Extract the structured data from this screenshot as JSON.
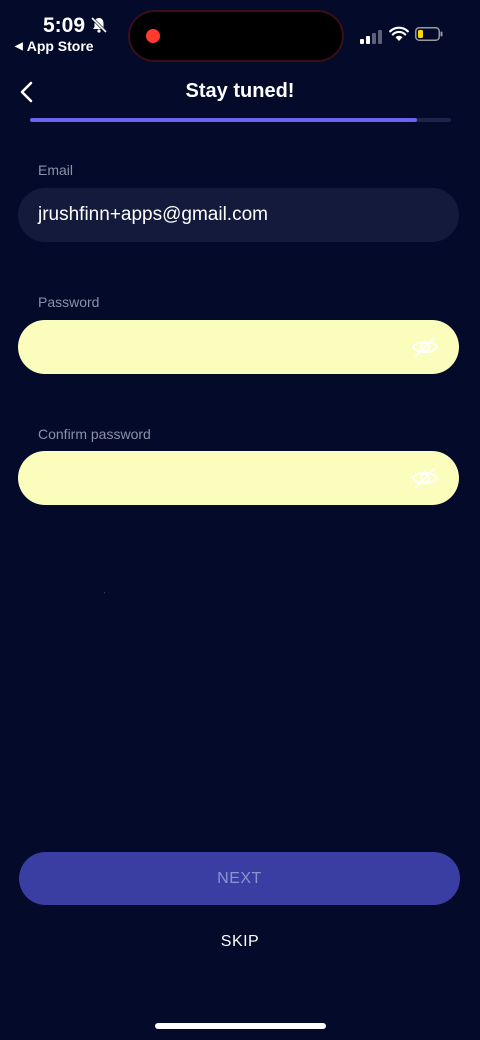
{
  "status_bar": {
    "time": "5:09",
    "back_app_label": "App Store",
    "back_arrow": "◀",
    "icons": [
      "bell-slash-icon",
      "cellular-signal-icon",
      "wifi-icon",
      "battery-low-icon"
    ],
    "recording_indicator_color": "#ff3b30"
  },
  "header": {
    "title": "Stay tuned!",
    "back_icon": "chevron-left-icon",
    "progress_fraction": 0.92
  },
  "form": {
    "email": {
      "label": "Email",
      "value": "jrushfinn+apps@gmail.com"
    },
    "password": {
      "label": "Password",
      "value": "",
      "autofill_color": "#fbfdbd",
      "eye_icon": "eye-slash-icon"
    },
    "confirm_password": {
      "label": "Confirm password",
      "value": "",
      "autofill_color": "#fbfdbd",
      "eye_icon": "eye-slash-icon"
    },
    "stray_mark": "ˏ"
  },
  "actions": {
    "next_label": "NEXT",
    "skip_label": "SKIP"
  },
  "colors": {
    "background": "#030a2a",
    "accent": "#6a64ef",
    "next_button": "#3a3ea3"
  }
}
